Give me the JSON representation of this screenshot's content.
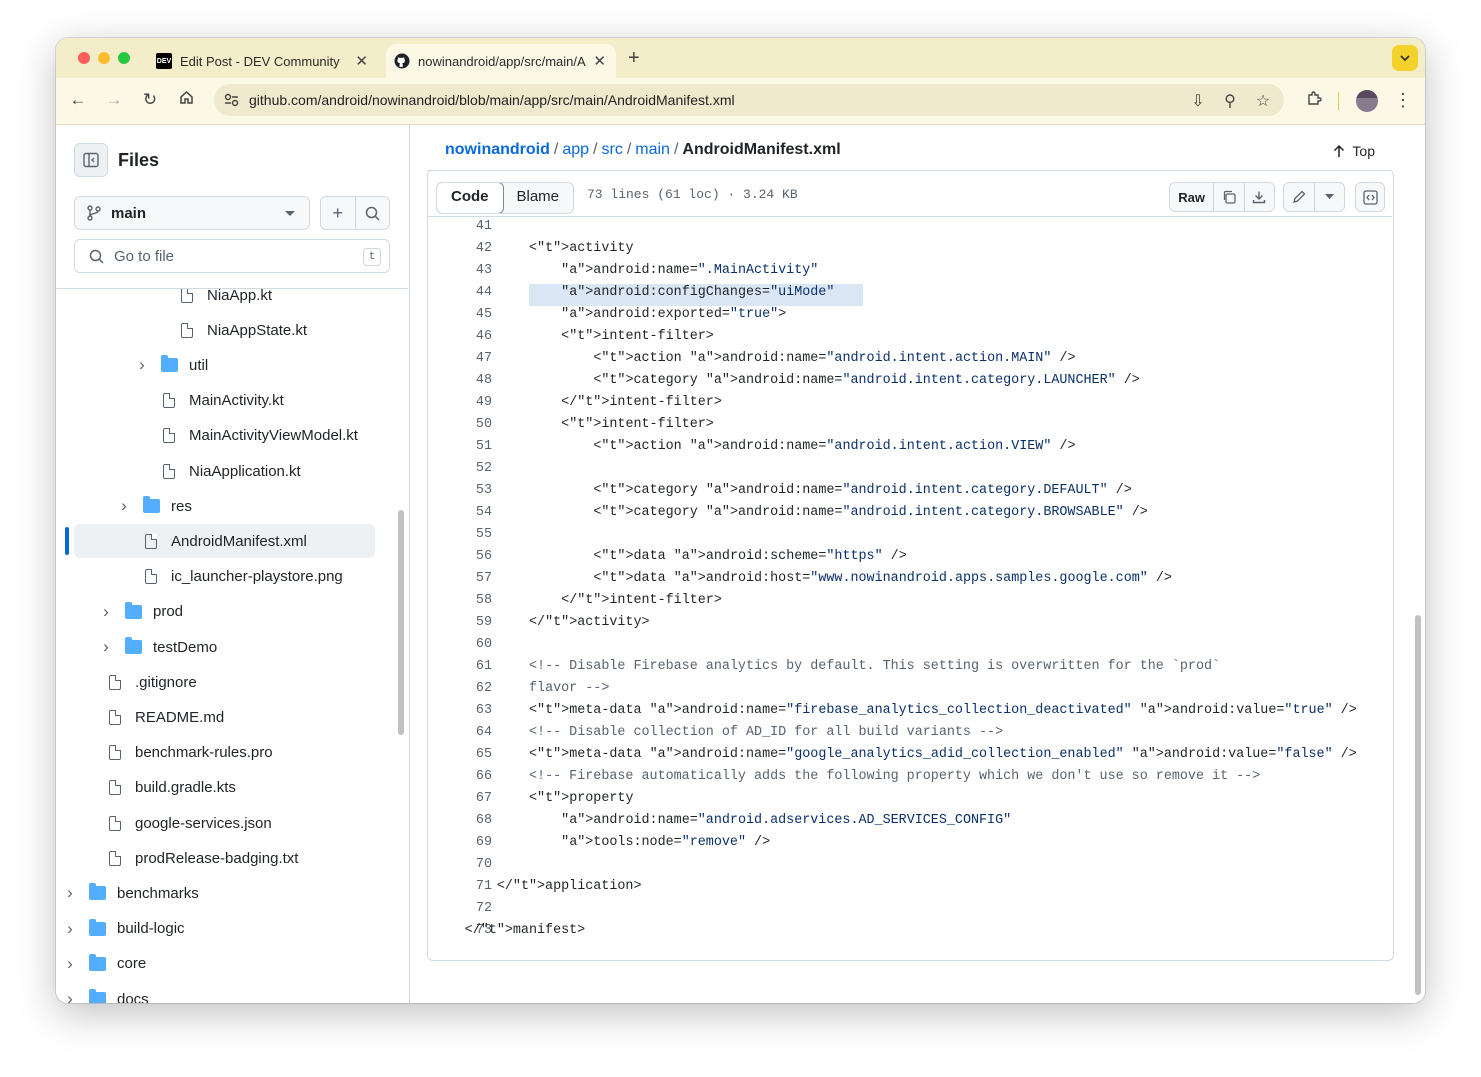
{
  "browser": {
    "tabs": [
      {
        "favicon": "DEV",
        "title": "Edit Post - DEV Community",
        "active": false
      },
      {
        "favicon": "github-icon",
        "title": "nowinandroid/app/src/main/A",
        "active": true
      }
    ],
    "new_tab": "+",
    "url": "github.com/android/nowinandroid/blob/main/app/src/main/AndroidManifest.xml"
  },
  "sidebar": {
    "title": "Files",
    "branch": "main",
    "search_placeholder": "Go to file",
    "search_shortcut": "t",
    "tree": [
      {
        "name": "NiaApp.kt",
        "type": "file",
        "depth": 4
      },
      {
        "name": "NiaAppState.kt",
        "type": "file",
        "depth": 4
      },
      {
        "name": "util",
        "type": "folder",
        "depth": 3
      },
      {
        "name": "MainActivity.kt",
        "type": "file",
        "depth": 3
      },
      {
        "name": "MainActivityViewModel.kt",
        "type": "file",
        "depth": 3
      },
      {
        "name": "NiaApplication.kt",
        "type": "file",
        "depth": 3
      },
      {
        "name": "res",
        "type": "folder",
        "depth": 2
      },
      {
        "name": "AndroidManifest.xml",
        "type": "file",
        "depth": 2,
        "selected": true
      },
      {
        "name": "ic_launcher-playstore.png",
        "type": "file",
        "depth": 2
      },
      {
        "name": "prod",
        "type": "folder",
        "depth": 1
      },
      {
        "name": "testDemo",
        "type": "folder",
        "depth": 1
      },
      {
        "name": ".gitignore",
        "type": "file",
        "depth": 0
      },
      {
        "name": "README.md",
        "type": "file",
        "depth": 0
      },
      {
        "name": "benchmark-rules.pro",
        "type": "file",
        "depth": 0
      },
      {
        "name": "build.gradle.kts",
        "type": "file",
        "depth": 0
      },
      {
        "name": "google-services.json",
        "type": "file",
        "depth": 0
      },
      {
        "name": "prodRelease-badging.txt",
        "type": "file",
        "depth": 0
      },
      {
        "name": "benchmarks",
        "type": "folder",
        "depth": -1
      },
      {
        "name": "build-logic",
        "type": "folder",
        "depth": -1
      },
      {
        "name": "core",
        "type": "folder",
        "depth": -1
      },
      {
        "name": "docs",
        "type": "folder",
        "depth": -1
      }
    ]
  },
  "main": {
    "breadcrumb": [
      {
        "label": "nowinandroid",
        "link": true
      },
      {
        "label": "app",
        "link": true
      },
      {
        "label": "src",
        "link": true
      },
      {
        "label": "main",
        "link": true
      },
      {
        "label": "AndroidManifest.xml",
        "link": false
      }
    ],
    "top_label": "Top",
    "tabs": {
      "code": "Code",
      "blame": "Blame"
    },
    "meta": "73 lines (61 loc) · 3.24 KB",
    "raw_label": "Raw",
    "highlighted_line": 44,
    "code_lines": [
      {
        "n": "41",
        "text": ""
      },
      {
        "n": "42",
        "text": "        <activity"
      },
      {
        "n": "43",
        "text": "            android:name=\".MainActivity\""
      },
      {
        "n": "44",
        "text": "            android:configChanges=\"uiMode\""
      },
      {
        "n": "45",
        "text": "            android:exported=\"true\">"
      },
      {
        "n": "46",
        "text": "            <intent-filter>"
      },
      {
        "n": "47",
        "text": "                <action android:name=\"android.intent.action.MAIN\" />"
      },
      {
        "n": "48",
        "text": "                <category android:name=\"android.intent.category.LAUNCHER\" />"
      },
      {
        "n": "49",
        "text": "            </intent-filter>"
      },
      {
        "n": "50",
        "text": "            <intent-filter>"
      },
      {
        "n": "51",
        "text": "                <action android:name=\"android.intent.action.VIEW\" />"
      },
      {
        "n": "52",
        "text": ""
      },
      {
        "n": "53",
        "text": "                <category android:name=\"android.intent.category.DEFAULT\" />"
      },
      {
        "n": "54",
        "text": "                <category android:name=\"android.intent.category.BROWSABLE\" />"
      },
      {
        "n": "55",
        "text": ""
      },
      {
        "n": "56",
        "text": "                <data android:scheme=\"https\" />"
      },
      {
        "n": "57",
        "text": "                <data android:host=\"www.nowinandroid.apps.samples.google.com\" />"
      },
      {
        "n": "58",
        "text": "            </intent-filter>"
      },
      {
        "n": "59",
        "text": "        </activity>"
      },
      {
        "n": "60",
        "text": ""
      },
      {
        "n": "61",
        "text": "        <!-- Disable Firebase analytics by default. This setting is overwritten for the `prod`"
      },
      {
        "n": "62",
        "text": "        flavor -->"
      },
      {
        "n": "63",
        "text": "        <meta-data android:name=\"firebase_analytics_collection_deactivated\" android:value=\"true\" />"
      },
      {
        "n": "64",
        "text": "        <!-- Disable collection of AD_ID for all build variants -->"
      },
      {
        "n": "65",
        "text": "        <meta-data android:name=\"google_analytics_adid_collection_enabled\" android:value=\"false\" />"
      },
      {
        "n": "66",
        "text": "        <!-- Firebase automatically adds the following property which we don't use so remove it -->"
      },
      {
        "n": "67",
        "text": "        <property"
      },
      {
        "n": "68",
        "text": "            android:name=\"android.adservices.AD_SERVICES_CONFIG\""
      },
      {
        "n": "69",
        "text": "            tools:node=\"remove\" />"
      },
      {
        "n": "70",
        "text": ""
      },
      {
        "n": "71",
        "text": "    </application>"
      },
      {
        "n": "72",
        "text": ""
      },
      {
        "n": "73",
        "text": "</manifest>"
      }
    ]
  }
}
